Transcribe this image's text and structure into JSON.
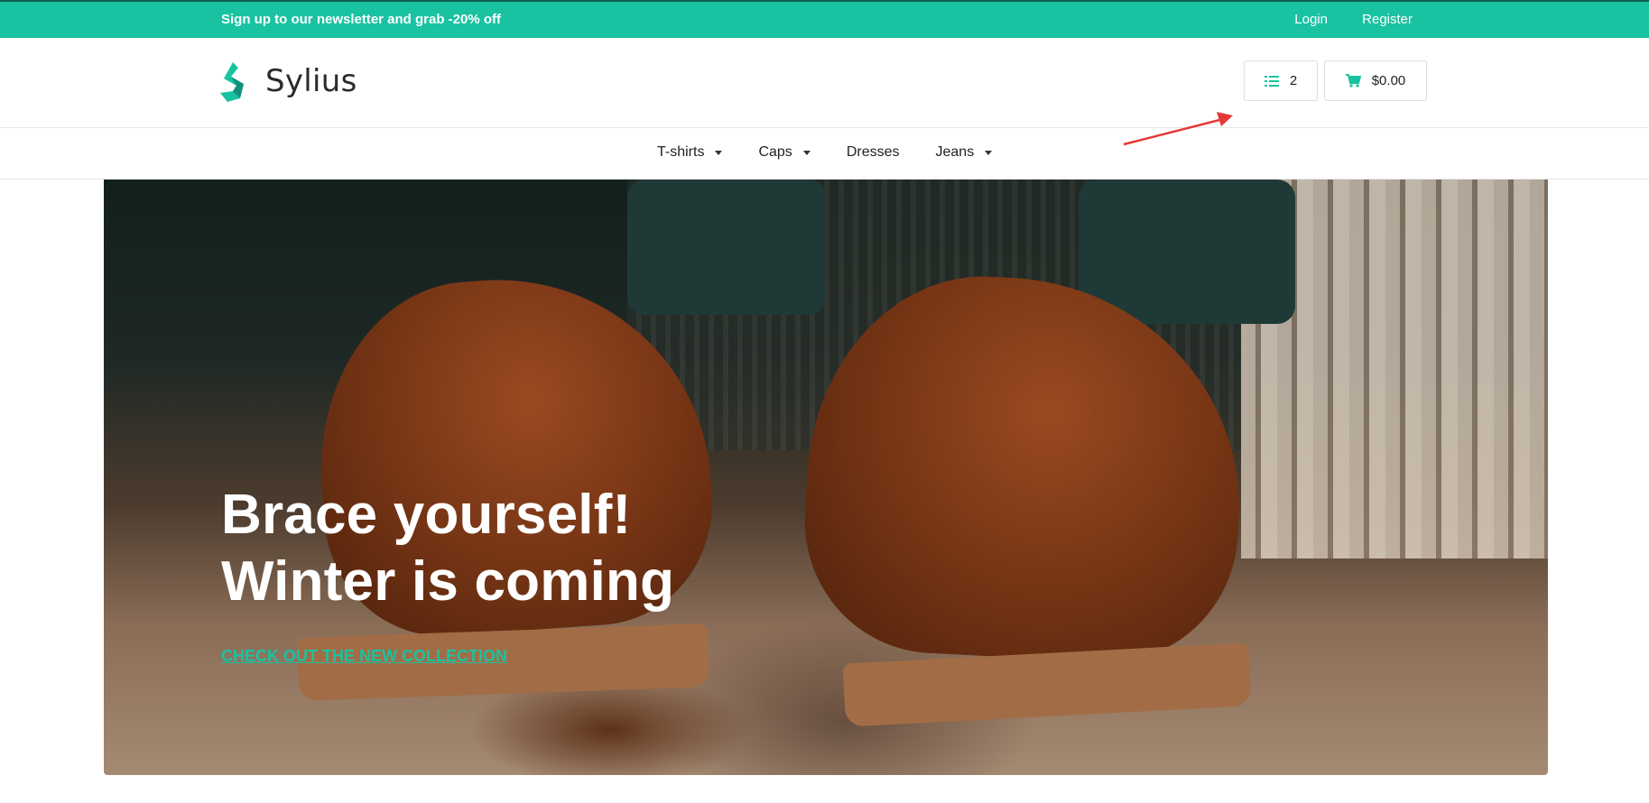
{
  "topbar": {
    "promo": "Sign up to our newsletter and grab -20% off",
    "login": "Login",
    "register": "Register"
  },
  "header": {
    "brand": "Sylius",
    "compare_count": "2",
    "cart_total": "$0.00"
  },
  "nav": {
    "items": [
      {
        "label": "T-shirts",
        "has_dropdown": true
      },
      {
        "label": "Caps",
        "has_dropdown": true
      },
      {
        "label": "Dresses",
        "has_dropdown": false
      },
      {
        "label": "Jeans",
        "has_dropdown": true
      }
    ]
  },
  "hero": {
    "line1": "Brace yourself!",
    "line2": "Winter is coming",
    "cta": "CHECK OUT THE NEW COLLECTION"
  },
  "colors": {
    "accent": "#19c2a1",
    "annotation_arrow": "#e53935"
  },
  "icons": [
    "list-icon",
    "cart-icon",
    "sylius-logo",
    "caret-down-icon"
  ]
}
